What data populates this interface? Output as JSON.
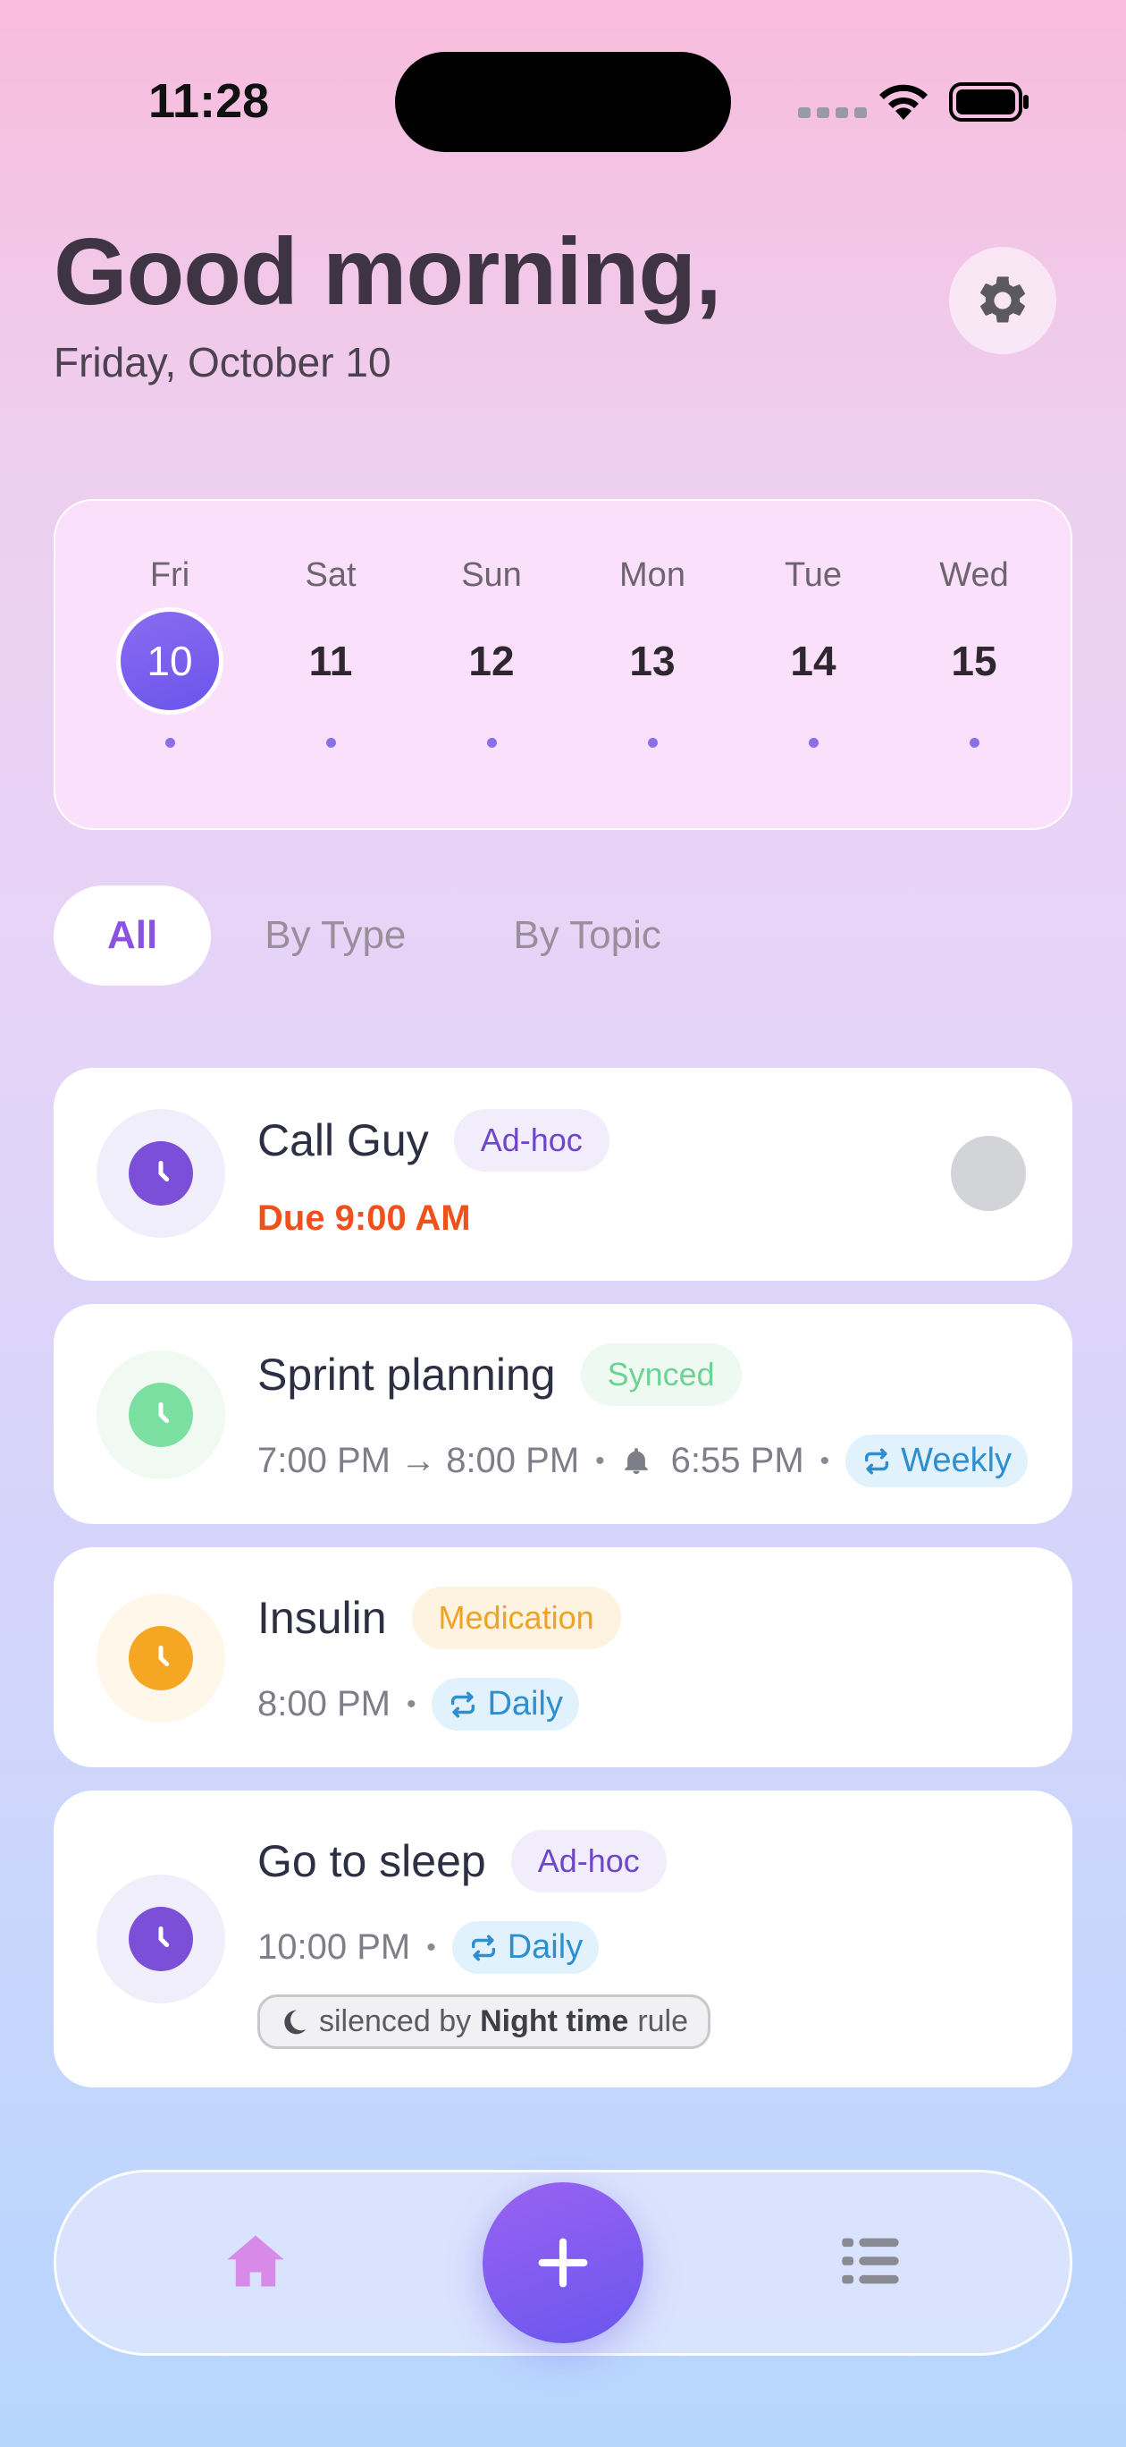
{
  "status_bar": {
    "time": "11:28"
  },
  "header": {
    "greeting": "Good morning,",
    "date": "Friday, October 10"
  },
  "calendar": {
    "days": [
      {
        "name": "Fri",
        "number": "10",
        "selected": true
      },
      {
        "name": "Sat",
        "number": "11"
      },
      {
        "name": "Sun",
        "number": "12"
      },
      {
        "name": "Mon",
        "number": "13"
      },
      {
        "name": "Tue",
        "number": "14"
      },
      {
        "name": "Wed",
        "number": "15"
      }
    ]
  },
  "filters": {
    "tabs": [
      "All",
      "By Type",
      "By Topic"
    ],
    "active": "All"
  },
  "reminders": [
    {
      "title": "Call Guy",
      "badge": "Ad-hoc",
      "due": "Due 9:00 AM",
      "color": "#7B4FD8"
    },
    {
      "title": "Sprint planning",
      "badge": "Synced",
      "time": "7:00 PM → 8:00 PM",
      "alert": "6:55 PM",
      "repeat": "Weekly",
      "color": "#7ADFA0"
    },
    {
      "title": "Insulin",
      "badge": "Medication",
      "time": "8:00 PM",
      "repeat": "Daily",
      "color": "#F5A623"
    },
    {
      "title": "Go to sleep",
      "badge": "Ad-hoc",
      "time": "10:00 PM",
      "repeat": "Daily",
      "silenced_prefix": "silenced by",
      "silenced_rule": "Night time",
      "silenced_suffix": "rule",
      "color": "#7B4FD8"
    }
  ],
  "nav": {
    "icons": [
      "home-icon",
      "plus-icon",
      "list-icon"
    ]
  }
}
